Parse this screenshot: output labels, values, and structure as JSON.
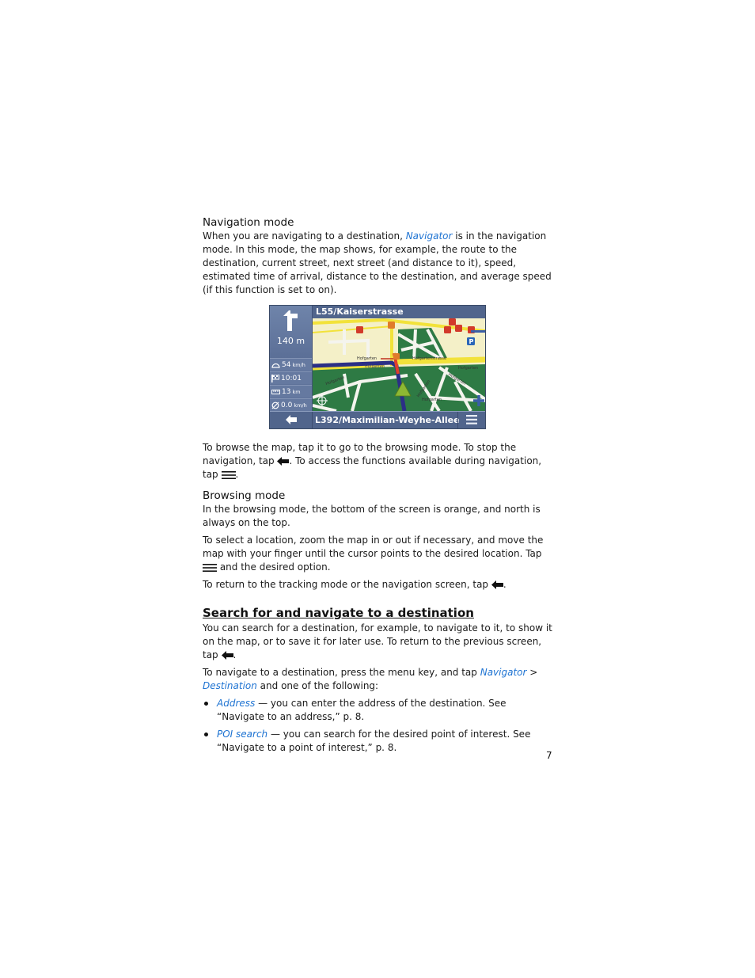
{
  "sections": {
    "navigation_mode": {
      "heading": "Navigation mode",
      "para1_pre": "When you are navigating to a destination, ",
      "para1_link": "Navigator",
      "para1_post": " is in the navigation mode. In this mode, the map shows, for example, the route to the destination, current street, next street (and distance to it), speed, estimated time of arrival, distance to the destination, and average speed (if this function is set to on).",
      "para2_pre": "To browse the map, tap it to go to the browsing mode. To stop the navigation, tap ",
      "para2_mid": ". To access the functions available during navigation, tap ",
      "para2_post": "."
    },
    "browsing_mode": {
      "heading": "Browsing mode",
      "para1": "In the browsing mode, the bottom of the screen is orange, and north is always on the top.",
      "para2_pre": "To select a location, zoom the map in or out if necessary, and move the map with your finger until the cursor points to the desired location. Tap ",
      "para2_post": " and the desired option.",
      "para3_pre": "To return to the tracking mode or the navigation screen, tap ",
      "para3_post": "."
    },
    "search": {
      "heading": "Search for and navigate to a destination",
      "para1_pre": "You can search for a destination, for example, to navigate to it, to show it on the map, or to save it for later use. To return to the previous screen, tap ",
      "para1_post": ".",
      "para2_pre": "To navigate to a destination, press the menu key, and tap ",
      "para2_link1": "Navigator",
      "para2_sep": " > ",
      "para2_link2": "Destination",
      "para2_post": " and one of the following:",
      "bullets": [
        {
          "link": "Address",
          "text": " — you can enter the address of the destination. See “Navigate to an address,” p. 8."
        },
        {
          "link": "POI search",
          "text": " — you can search for the desired point of interest. See “Navigate to a point of interest,” p. 8."
        }
      ]
    }
  },
  "screenshot": {
    "current_street": "L55/Kaiserstrasse",
    "next_street": "L392/Maximilian-Weyhe-Allee",
    "turn_distance": "140 m",
    "speed": "54",
    "speed_unit": "km/h",
    "eta": "10:01",
    "distance_remaining": "13",
    "distance_unit": "km",
    "avg_speed": "0.0",
    "avg_speed_unit": "km/h",
    "map_labels": [
      "Hofgarten",
      "Hofgarten",
      "Hofgartenstrasse",
      "Hofgarten",
      "Hofgarten",
      "Hofgarten",
      "Hofgarten",
      "Hofgarten"
    ]
  },
  "page_number": "7",
  "colors": {
    "link": "#1e73d2",
    "toolbar": "#51658c",
    "park": "#2e7a44",
    "road_main": "#f2e23a",
    "route": "#2b2f86"
  }
}
